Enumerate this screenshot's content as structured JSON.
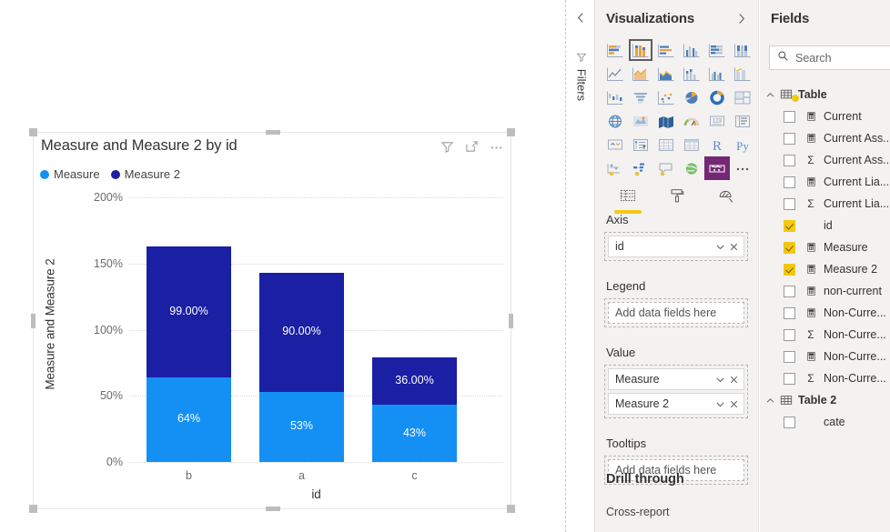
{
  "canvas": {
    "visual": {
      "title": "Measure and Measure 2 by id",
      "header_icons": [
        {
          "name": "filter-icon"
        },
        {
          "name": "focus-mode-icon"
        },
        {
          "name": "more-options-icon"
        }
      ]
    }
  },
  "chart_data": {
    "type": "bar",
    "stacked": true,
    "title": "Measure and Measure 2 by id",
    "xlabel": "id",
    "ylabel": "Measure and Measure 2",
    "categories": [
      "b",
      "a",
      "c"
    ],
    "series": [
      {
        "name": "Measure",
        "color": "#1490F5",
        "values": [
          64,
          53,
          43
        ],
        "labels": [
          "64%",
          "53%",
          "43%"
        ]
      },
      {
        "name": "Measure 2",
        "color": "#1A1FA3",
        "values": [
          99,
          90,
          36
        ],
        "labels": [
          "99.00%",
          "90.00%",
          "36.00%"
        ]
      }
    ],
    "ylim": [
      0,
      200
    ],
    "yticks": [
      0,
      50,
      100,
      150,
      200
    ],
    "ytick_labels": [
      "0%",
      "50%",
      "100%",
      "150%",
      "200%"
    ],
    "grid": true,
    "legend_position": "top-left",
    "legend": [
      "Measure",
      "Measure 2"
    ]
  },
  "filters_rail": {
    "label": "Filters",
    "collapse_icon": "chevron-left-icon",
    "funnel_icon": "filter-icon"
  },
  "visualizations": {
    "title": "Visualizations",
    "expand_icon": "chevron-right-icon",
    "gallery": [
      {
        "name": "stacked-bar-chart",
        "selected": false
      },
      {
        "name": "stacked-column-chart",
        "selected": true
      },
      {
        "name": "clustered-bar-chart",
        "selected": false
      },
      {
        "name": "clustered-column-chart",
        "selected": false
      },
      {
        "name": "100-percent-stacked-bar-chart",
        "selected": false
      },
      {
        "name": "100-percent-stacked-column-chart",
        "selected": false
      },
      {
        "name": "line-chart",
        "selected": false
      },
      {
        "name": "area-chart",
        "selected": false
      },
      {
        "name": "stacked-area-chart",
        "selected": false
      },
      {
        "name": "line-and-stacked-column-chart",
        "selected": false
      },
      {
        "name": "line-and-clustered-column-chart",
        "selected": false
      },
      {
        "name": "ribbon-chart",
        "selected": false
      },
      {
        "name": "waterfall-chart",
        "selected": false
      },
      {
        "name": "funnel-chart",
        "selected": false
      },
      {
        "name": "scatter-chart",
        "selected": false
      },
      {
        "name": "pie-chart",
        "selected": false
      },
      {
        "name": "donut-chart",
        "selected": false
      },
      {
        "name": "treemap-chart",
        "selected": false
      },
      {
        "name": "map-visual",
        "selected": false
      },
      {
        "name": "filled-map-visual",
        "selected": false
      },
      {
        "name": "shape-map-visual",
        "selected": false
      },
      {
        "name": "gauge-visual",
        "selected": false
      },
      {
        "name": "card-visual",
        "selected": false
      },
      {
        "name": "multi-row-card-visual",
        "selected": false
      },
      {
        "name": "kpi-visual",
        "selected": false
      },
      {
        "name": "slicer-visual",
        "selected": false
      },
      {
        "name": "table-visual",
        "selected": false
      },
      {
        "name": "matrix-visual",
        "selected": false
      },
      {
        "name": "r-script-visual",
        "selected": false,
        "text": "R"
      },
      {
        "name": "python-script-visual",
        "selected": false,
        "text": "Py"
      },
      {
        "name": "key-influencers-visual",
        "selected": false
      },
      {
        "name": "decomposition-tree-visual",
        "selected": false
      },
      {
        "name": "qna-visual",
        "selected": false
      },
      {
        "name": "arcgis-maps-visual",
        "selected": false
      },
      {
        "name": "power-apps-visual",
        "selected": false,
        "purple": true
      },
      {
        "name": "more-visuals-icon",
        "selected": false
      }
    ],
    "tabs": [
      {
        "name": "fields-tab",
        "icon": "fields-table-icon",
        "active": true
      },
      {
        "name": "format-tab",
        "icon": "paint-roller-icon",
        "active": false
      },
      {
        "name": "analytics-tab",
        "icon": "magnifier-chart-icon",
        "active": false
      }
    ],
    "wells": [
      {
        "label": "Axis",
        "chips": [
          "id"
        ],
        "placeholder": null
      },
      {
        "label": "Legend",
        "chips": [],
        "placeholder": "Add data fields here"
      },
      {
        "label": "Value",
        "chips": [
          "Measure",
          "Measure 2"
        ],
        "placeholder": null
      },
      {
        "label": "Tooltips",
        "chips": [],
        "placeholder": "Add data fields here"
      }
    ],
    "drill_through": {
      "title": "Drill through",
      "cross_report": "Cross-report"
    }
  },
  "fields": {
    "title": "Fields",
    "search_placeholder": "Search",
    "search_icon": "search-icon",
    "tables": [
      {
        "name": "Table",
        "expanded": true,
        "items": [
          {
            "label": "Current",
            "checked": false,
            "type": "calculator"
          },
          {
            "label": "Current Ass...",
            "checked": false,
            "type": "calculator"
          },
          {
            "label": "Current Ass...",
            "checked": false,
            "type": "sigma"
          },
          {
            "label": "Current Lia...",
            "checked": false,
            "type": "calculator"
          },
          {
            "label": "Current Lia...",
            "checked": false,
            "type": "sigma"
          },
          {
            "label": "id",
            "checked": true,
            "type": "none"
          },
          {
            "label": "Measure",
            "checked": true,
            "type": "calculator"
          },
          {
            "label": "Measure 2",
            "checked": true,
            "type": "calculator"
          },
          {
            "label": "non-current",
            "checked": false,
            "type": "calculator"
          },
          {
            "label": "Non-Curre...",
            "checked": false,
            "type": "calculator"
          },
          {
            "label": "Non-Curre...",
            "checked": false,
            "type": "sigma"
          },
          {
            "label": "Non-Curre...",
            "checked": false,
            "type": "calculator"
          },
          {
            "label": "Non-Curre...",
            "checked": false,
            "type": "sigma"
          }
        ]
      },
      {
        "name": "Table 2",
        "expanded": true,
        "items": [
          {
            "label": "cate",
            "checked": false,
            "type": "none"
          }
        ]
      }
    ]
  }
}
